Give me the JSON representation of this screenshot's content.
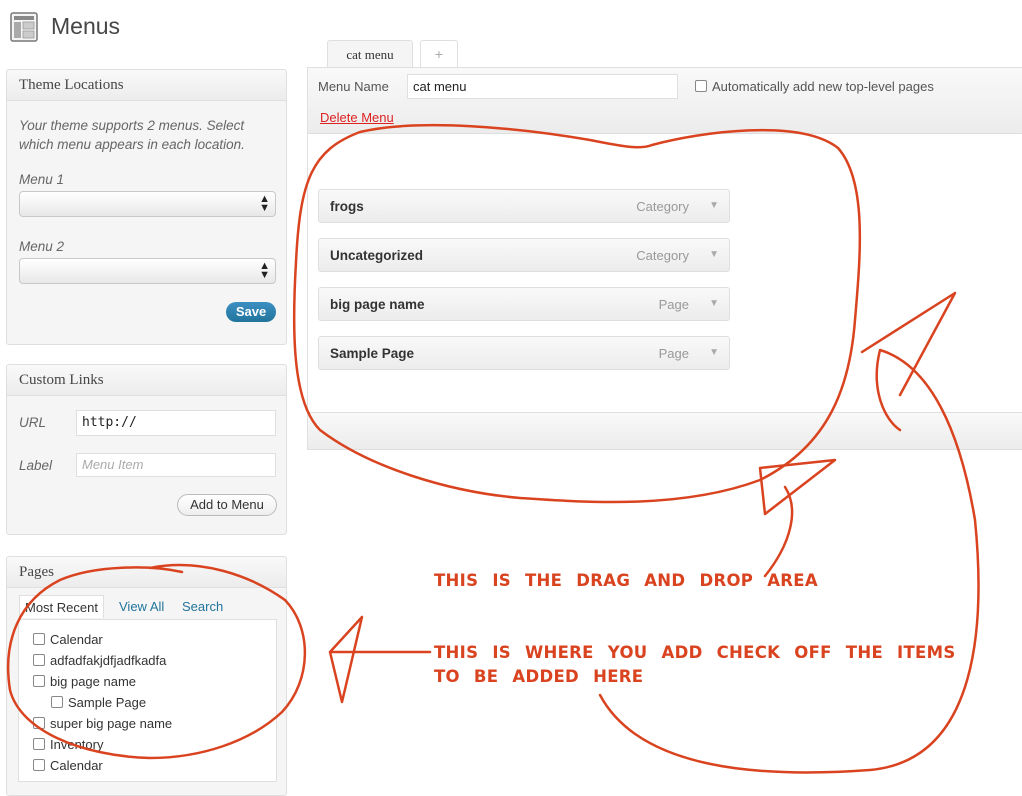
{
  "page": {
    "title": "Menus"
  },
  "theme_locations": {
    "heading": "Theme Locations",
    "description_line1": "Your theme supports 2 menus. Select",
    "description_line2": "which menu appears in each location.",
    "menu1_label": "Menu 1",
    "menu1_value": "",
    "menu2_label": "Menu 2",
    "menu2_value": "",
    "save_label": "Save"
  },
  "custom_links": {
    "heading": "Custom Links",
    "url_label": "URL",
    "url_value": "http://",
    "label_label": "Label",
    "label_placeholder": "Menu Item",
    "add_button": "Add to Menu"
  },
  "pages_box": {
    "heading": "Pages",
    "tabs": [
      "Most Recent",
      "View All",
      "Search"
    ],
    "items": [
      {
        "label": "Calendar",
        "indent": 0
      },
      {
        "label": "adfadfakjdfjadfkadfa",
        "indent": 0
      },
      {
        "label": "big page name",
        "indent": 0
      },
      {
        "label": "Sample Page",
        "indent": 1
      },
      {
        "label": "super big page name",
        "indent": 0
      },
      {
        "label": "Inventory",
        "indent": 0
      },
      {
        "label": "Calendar",
        "indent": 0
      }
    ]
  },
  "menu_editor": {
    "tabs": [
      "cat menu",
      "+"
    ],
    "menu_name_label": "Menu Name",
    "menu_name_value": "cat menu",
    "auto_add_label": "Automatically add new top-level pages",
    "delete_label": "Delete Menu",
    "items": [
      {
        "title": "frogs",
        "type": "Category"
      },
      {
        "title": "Uncategorized",
        "type": "Category"
      },
      {
        "title": "big page name",
        "type": "Page"
      },
      {
        "title": "Sample Page",
        "type": "Page"
      }
    ]
  },
  "annotations": {
    "drag_drop": "THIS IS THE DRAG AND DROP AREA",
    "add_line1": "THIS IS WHERE YOU ADD CHECK OFF THE ITEMS",
    "add_line2": "TO BE ADDED HERE",
    "color": "#d9431f"
  }
}
